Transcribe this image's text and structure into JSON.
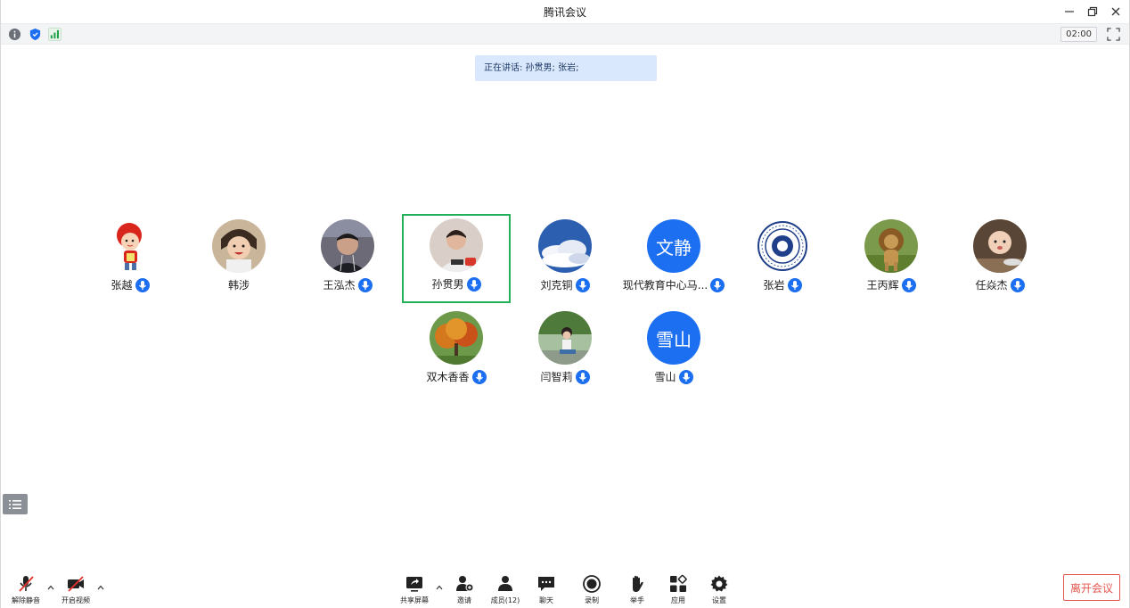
{
  "window": {
    "title": "腾讯会议"
  },
  "status": {
    "timer": "02:00"
  },
  "speaking": {
    "text": "正在讲话: 孙贯男; 张岩;"
  },
  "participants": [
    {
      "name": "张越",
      "avatar": "cartoon-girl"
    },
    {
      "name": "韩涉",
      "avatar": "child-photo"
    },
    {
      "name": "王泓杰",
      "avatar": "man-photo"
    },
    {
      "name": "孙贯男",
      "avatar": "man-photo-2",
      "active": true
    },
    {
      "name": "刘克铜",
      "avatar": "sky-clouds"
    },
    {
      "name": "现代教育中心马...",
      "avatar_text": "文静"
    },
    {
      "name": "张岩",
      "avatar": "university-seal"
    },
    {
      "name": "王丙辉",
      "avatar": "lion"
    },
    {
      "name": "任焱杰",
      "avatar": "baby-photo"
    },
    {
      "name": "双木香香",
      "avatar": "autumn-tree"
    },
    {
      "name": "闫智莉",
      "avatar": "woman-outdoor"
    },
    {
      "name": "雪山",
      "avatar_text": "雪山"
    }
  ],
  "toolbar": {
    "unmute": "解除静音",
    "start_video": "开启视频",
    "share_screen": "共享屏幕",
    "invite": "邀请",
    "members": "成员(12)",
    "chat": "聊天",
    "record": "录制",
    "raise_hand": "举手",
    "apps": "应用",
    "settings": "设置",
    "leave": "离开会议"
  },
  "colors": {
    "accent": "#1c6ff0",
    "active_border": "#22b05a",
    "leave": "#e5554f",
    "banner": "#d9e8fc"
  }
}
